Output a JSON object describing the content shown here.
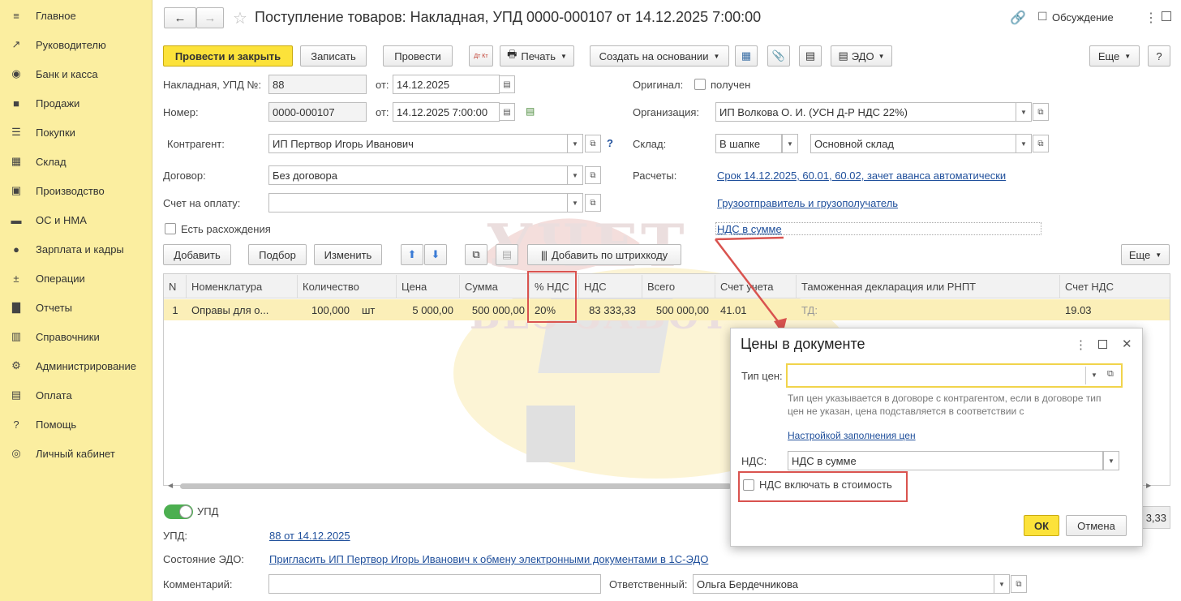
{
  "sidebar": {
    "items": [
      {
        "label": "Главное",
        "icon": "menu-icon"
      },
      {
        "label": "Руководителю",
        "icon": "trend-icon"
      },
      {
        "label": "Банк и касса",
        "icon": "coin-icon"
      },
      {
        "label": "Продажи",
        "icon": "bag-icon"
      },
      {
        "label": "Покупки",
        "icon": "cart-icon"
      },
      {
        "label": "Склад",
        "icon": "warehouse-icon"
      },
      {
        "label": "Производство",
        "icon": "factory-icon"
      },
      {
        "label": "ОС и НМА",
        "icon": "truck-icon"
      },
      {
        "label": "Зарплата и кадры",
        "icon": "person-icon"
      },
      {
        "label": "Операции",
        "icon": "dt-kt-icon"
      },
      {
        "label": "Отчеты",
        "icon": "bar-chart-icon"
      },
      {
        "label": "Справочники",
        "icon": "books-icon"
      },
      {
        "label": "Администрирование",
        "icon": "gear-icon"
      },
      {
        "label": "Оплата",
        "icon": "payment-icon"
      },
      {
        "label": "Помощь",
        "icon": "help-icon"
      },
      {
        "label": "Личный кабинет",
        "icon": "account-icon"
      }
    ]
  },
  "header": {
    "title": "Поступление товаров: Накладная, УПД 0000-000107 от 14.12.2025 7:00:00",
    "discussion": "Обсуждение"
  },
  "toolbar": {
    "post_close": "Провести и закрыть",
    "save": "Записать",
    "post": "Провести",
    "dtkt": "Дт Кт",
    "print": "Печать",
    "create_based": "Создать на основании",
    "edo": "ЭДО",
    "more": "Еще",
    "help": "?"
  },
  "form": {
    "invoice_label": "Накладная, УПД №:",
    "invoice_value": "88",
    "from_label": "от:",
    "invoice_date": "14.12.2025",
    "number_label": "Номер:",
    "number_value": "0000-000107",
    "number_date": "14.12.2025  7:00:00",
    "original_label": "Оригинал:",
    "original_received": "получен",
    "org_label": "Организация:",
    "org_value": "ИП Волкова О. И. (УСН Д-Р НДС 22%)",
    "contractor_label": "Контрагент:",
    "contractor_value": "ИП Пертвор Игорь Иванович",
    "warehouse_label": "Склад:",
    "warehouse_mode": "В шапке",
    "warehouse_value": "Основной склад",
    "contract_label": "Договор:",
    "contract_value": "Без договора",
    "settlements_label": "Расчеты:",
    "settlements_link": "Срок 14.12.2025, 60.01, 60.02, зачет аванса автоматически",
    "payment_account_label": "Счет на оплату:",
    "payment_account_value": "",
    "shipper_link": "Грузоотправитель и грузополучатель",
    "discrepancy_label": "Есть расхождения",
    "vat_link": "НДС в сумме"
  },
  "table_toolbar": {
    "add": "Добавить",
    "pick": "Подбор",
    "edit": "Изменить",
    "barcode": "Добавить по штрихкоду",
    "more": "Еще"
  },
  "table": {
    "headers": [
      "N",
      "Номенклатура",
      "Количество",
      "Цена",
      "Сумма",
      "% НДС",
      "НДС",
      "Всего",
      "Счет учета",
      "Таможенная декларация или РНПТ",
      "Счет НДС"
    ],
    "rows": [
      {
        "n": "1",
        "item": "Оправы для о...",
        "qty": "100,000",
        "unit": "шт",
        "price": "5 000,00",
        "sum": "500 000,00",
        "vat_rate": "20%",
        "vat": "83 333,33",
        "total": "500 000,00",
        "account": "41.01",
        "customs": "ТД:",
        "vat_account": "19.03"
      }
    ]
  },
  "footer": {
    "upd_toggle": "УПД",
    "upd_label": "УПД:",
    "upd_link": "88 от 14.12.2025",
    "edo_state_label": "Состояние ЭДО:",
    "edo_state_link": "Пригласить ИП Пертвор Игорь Иванович к обмену электронными документами в 1С-ЭДО",
    "comment_label": "Комментарий:",
    "comment_value": "",
    "responsible_label": "Ответственный:",
    "responsible_value": "Ольга Бердечникова",
    "partial_total": "3,33"
  },
  "dialog": {
    "title": "Цены в документе",
    "price_type_label": "Тип цен:",
    "price_type_value": "",
    "hint": "Тип цен указывается в договоре с контрагентом, если в договоре тип цен не указан, цена подставляется в соответствии с",
    "hint_link": "Настройкой заполнения цен",
    "vat_label": "НДС:",
    "vat_value": "НДС в сумме",
    "include_vat_label": "НДС включать в стоимость",
    "ok": "ОК",
    "cancel": "Отмена"
  },
  "watermark": {
    "line1": "УЧЕТ",
    "line2": "БЕЗ ЗАБОТ"
  },
  "colors": {
    "sidebar_bg": "#fbeea0",
    "primary_button": "#fce23a",
    "link": "#1f4f9b",
    "row_highlight": "#fbefb8",
    "annotation_red": "#d9534f",
    "toggle_green": "#4caf50"
  }
}
